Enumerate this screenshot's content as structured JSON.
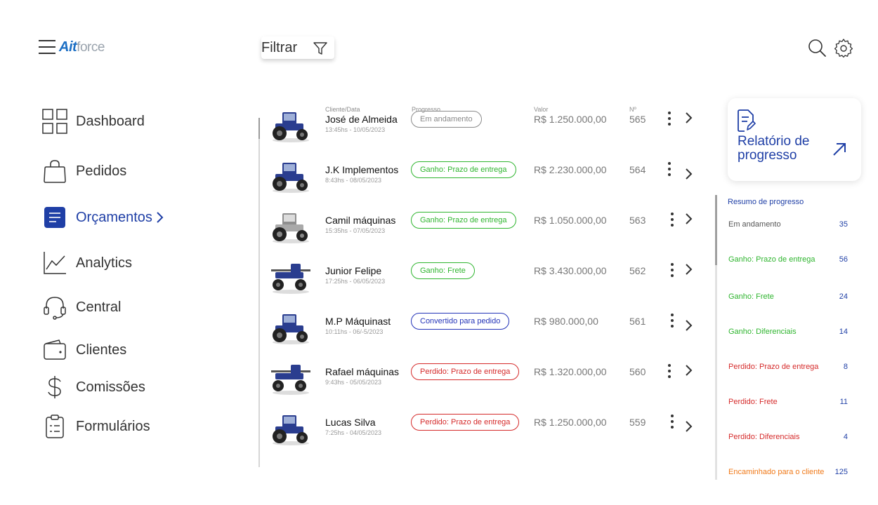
{
  "header": {
    "logo_mark": "Ait",
    "logo_word": "force",
    "filter_label": "Filtrar",
    "icons": [
      "menu-icon",
      "search-icon",
      "gear-icon",
      "filter-icon"
    ]
  },
  "sidebar": {
    "items": [
      {
        "label": "Dashboard",
        "icon": "dashboard-icon"
      },
      {
        "label": "Pedidos",
        "icon": "bag-icon"
      },
      {
        "label": "Orçamentos",
        "icon": "document-icon",
        "active": true
      },
      {
        "label": "Analytics",
        "icon": "chart-icon"
      },
      {
        "label": "Central",
        "icon": "headset-icon"
      },
      {
        "label": "Clientes",
        "icon": "wallet-icon"
      },
      {
        "label": "Comissões",
        "icon": "dollar-icon"
      },
      {
        "label": "Formulários",
        "icon": "clipboard-icon"
      }
    ]
  },
  "table": {
    "headers": {
      "client": "Cliente/Data",
      "progress": "Progresso",
      "value": "Valor",
      "number": "Nº"
    },
    "rows": [
      {
        "name": "José de Almeida",
        "date": "13:45hs - 10/05/2023",
        "status": "Em andamento",
        "status_color": "#8a8a8a",
        "value": "R$ 1.250.000,00",
        "number": "565",
        "tractor": "blue"
      },
      {
        "name": "J.K Implementos",
        "date": "8:43hs - 08/05/2023",
        "status": "Ganho: Prazo de entrega",
        "status_color": "#2fb52f",
        "value": "R$ 2.230.000,00",
        "number": "564",
        "tractor": "blue"
      },
      {
        "name": "Camil máquinas",
        "date": "15:35hs - 07/05/2023",
        "status": "Ganho: Prazo de entrega",
        "status_color": "#2fb52f",
        "value": "R$ 1.050.000,00",
        "number": "563",
        "tractor": "gray"
      },
      {
        "name": "Junior Felipe",
        "date": "17:25hs - 06/05/2023",
        "status": "Ganho: Frete",
        "status_color": "#2fb52f",
        "value": "R$ 3.430.000,00",
        "number": "562",
        "tractor": "sprayer"
      },
      {
        "name": "M.P Máquinast",
        "date": "10:11hs - 06/-5/2023",
        "status": "Convertido para pedido",
        "status_color": "#2333b8",
        "value": "R$ 980.000,00",
        "number": "561",
        "tractor": "blue"
      },
      {
        "name": "Rafael máquinas",
        "date": "9:43hs - 05/05/2023",
        "status": "Perdido: Prazo de entrega",
        "status_color": "#d52a2a",
        "value": "R$ 1.320.000,00",
        "number": "560",
        "tractor": "sprayer"
      },
      {
        "name": "Lucas Silva",
        "date": "7:25hs - 04/05/2023",
        "status": "Perdido: Prazo de entrega",
        "status_color": "#d52a2a",
        "value": "R$ 1.250.000,00",
        "number": "559",
        "tractor": "blue"
      }
    ]
  },
  "report_card": {
    "title": "Relatório de progresso"
  },
  "summary": {
    "title": "Resumo de progresso",
    "items": [
      {
        "label": "Em andamento",
        "count": "35",
        "color": "#555555"
      },
      {
        "label": "Ganho: Prazo de entrega",
        "count": "56",
        "color": "#2fb52f"
      },
      {
        "label": "Ganho: Frete",
        "count": "24",
        "color": "#2fb52f"
      },
      {
        "label": "Ganho: Diferenciais",
        "count": "14",
        "color": "#2fb52f"
      },
      {
        "label": "Perdido: Prazo de entrega",
        "count": "8",
        "color": "#d52a2a"
      },
      {
        "label": "Perdido: Frete",
        "count": "11",
        "color": "#d52a2a"
      },
      {
        "label": "Perdido: Diferenciais",
        "count": "4",
        "color": "#d52a2a"
      },
      {
        "label": "Encaminhado para o cliente",
        "count": "125",
        "color": "#f07a1a"
      }
    ]
  },
  "colors": {
    "accent": "#1f3fa6",
    "brand": "#1c6fc4"
  }
}
